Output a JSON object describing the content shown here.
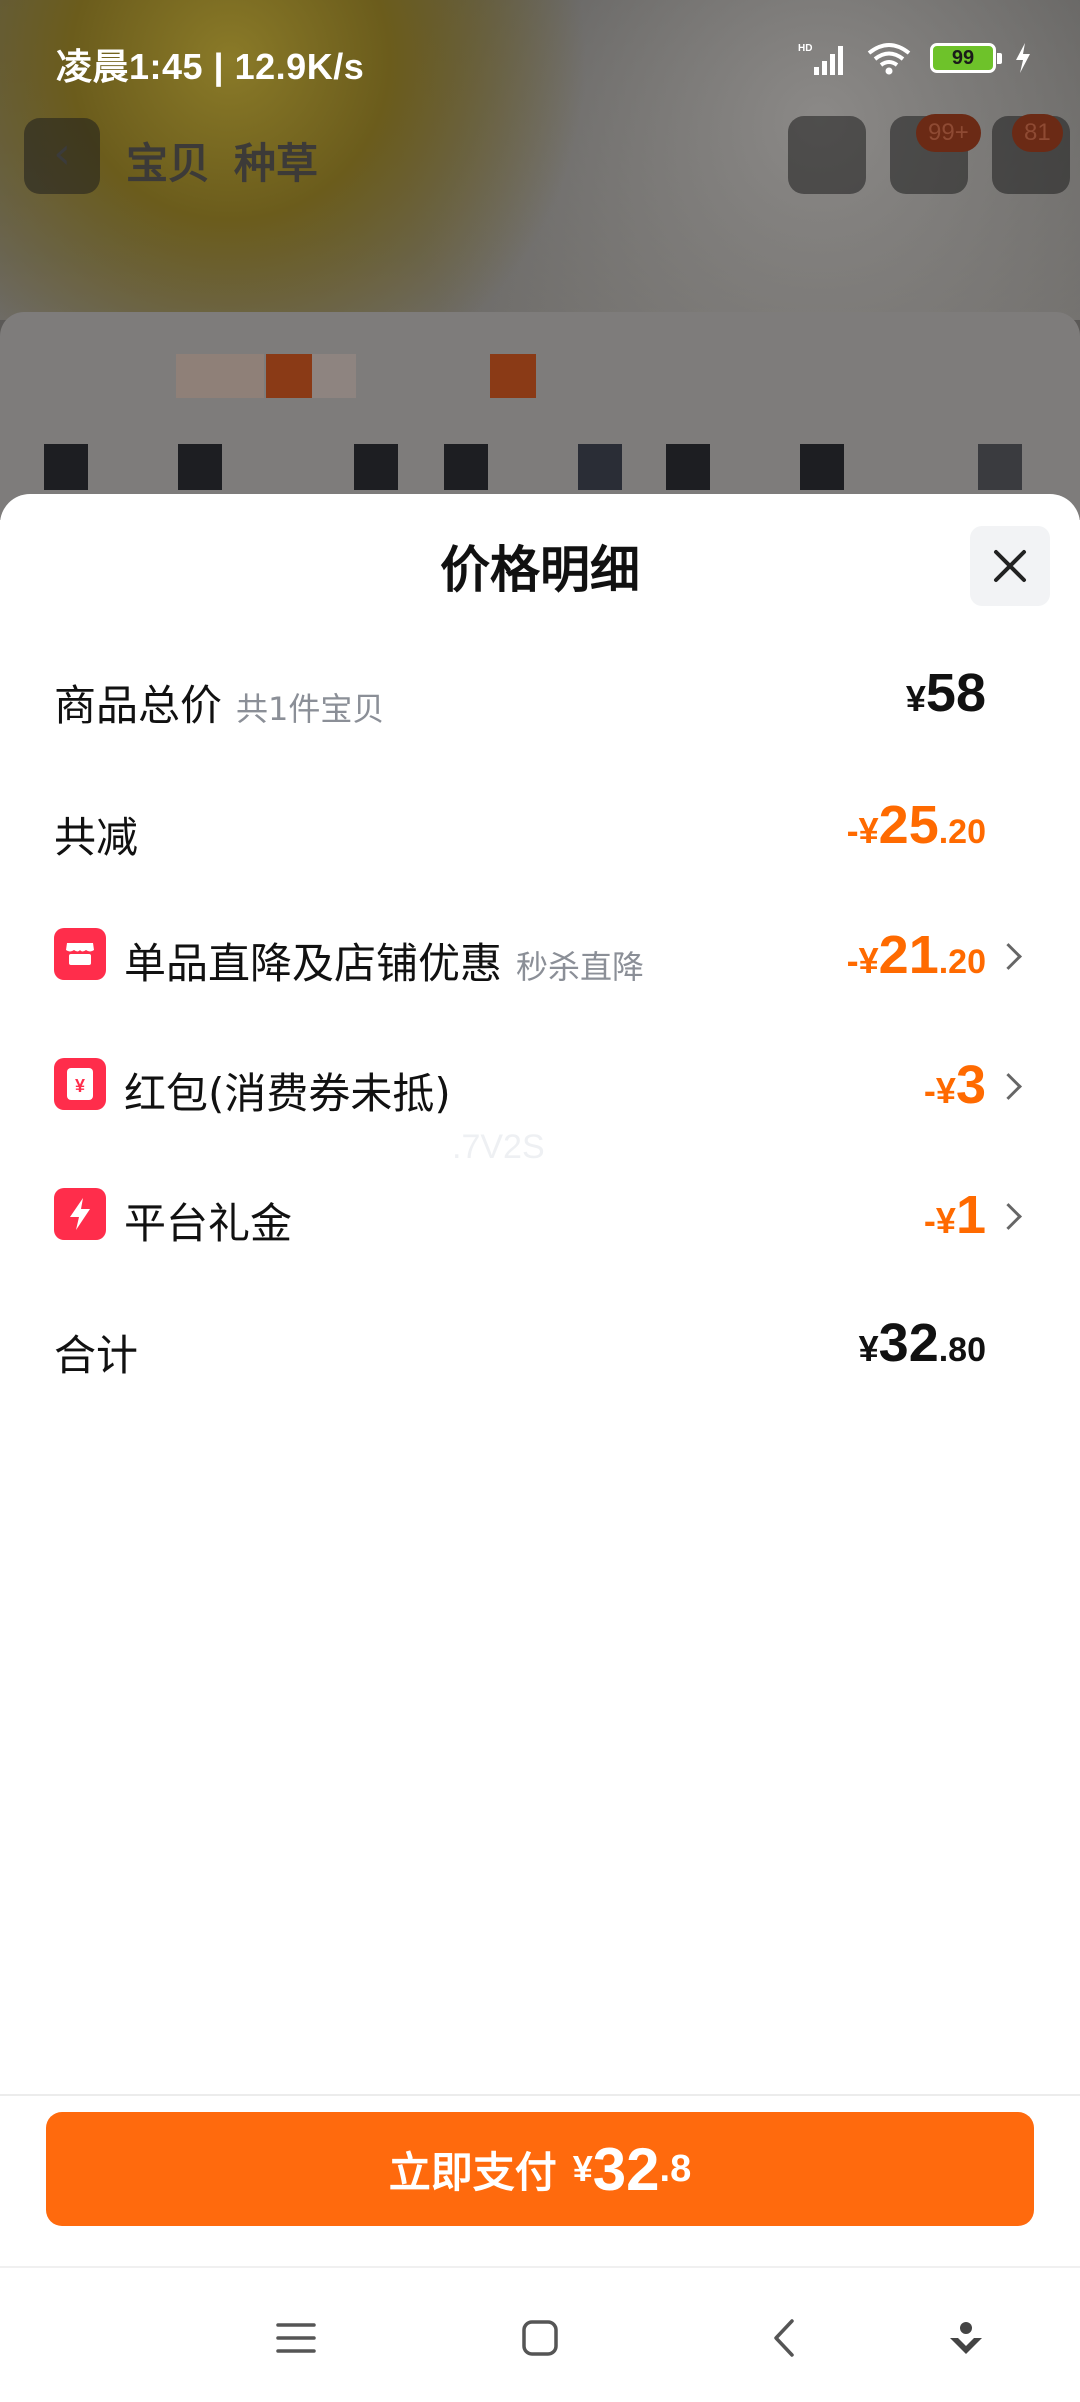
{
  "status_bar": {
    "time": "凌晨1:45 | 12.9K/s",
    "battery": "99",
    "icons": [
      "hd-signal-icon",
      "wifi-icon",
      "battery-icon",
      "charging-icon"
    ]
  },
  "product_nav": {
    "tabs": [
      "宝贝",
      "种草"
    ],
    "cart_badge": "99+",
    "more_badge": "81"
  },
  "sheet": {
    "title": "价格明细",
    "rows": [
      {
        "label": "商品总价",
        "sub": "共1件宝贝",
        "amount": {
          "sign": "",
          "currency": "¥",
          "int": "58",
          "dec": ""
        },
        "color": "dark"
      },
      {
        "label": "共减",
        "sub": "",
        "amount": {
          "sign": "-",
          "currency": "¥",
          "int": "25",
          "dec": ".20"
        },
        "color": "orange"
      },
      {
        "label": "单品直降及店铺优惠",
        "sub": "秒杀直降",
        "icon": "store-icon",
        "amount": {
          "sign": "-",
          "currency": "¥",
          "int": "21",
          "dec": ".20"
        },
        "color": "orange"
      },
      {
        "label": "红包(消费券未抵)",
        "sub": "",
        "icon": "red-packet-icon",
        "amount": {
          "sign": "-",
          "currency": "¥",
          "int": "3",
          "dec": ""
        },
        "color": "orange"
      },
      {
        "label": "平台礼金",
        "sub": "",
        "icon": "lightning-icon",
        "amount": {
          "sign": "-",
          "currency": "¥",
          "int": "1",
          "dec": ""
        },
        "color": "orange"
      },
      {
        "label": "合计",
        "sub": "",
        "amount": {
          "sign": "",
          "currency": "¥",
          "int": "32",
          "dec": ".80"
        },
        "color": "dark"
      }
    ],
    "watermark": ".7V2S"
  },
  "pay_button": {
    "label": "立即支付",
    "currency": "¥",
    "int": "32",
    "dec": ".8"
  },
  "colors": {
    "accent": "#ff6a00",
    "pay_button": "#ff6a0d",
    "promo_icon": "#ff2d4b",
    "text_primary": "#111111",
    "text_secondary": "#8b8f97"
  }
}
